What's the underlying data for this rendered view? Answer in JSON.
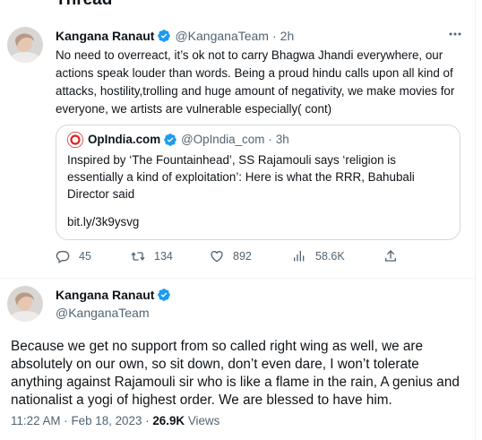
{
  "header": {
    "title": "Thread"
  },
  "tweet": {
    "author_name": "Kangana Ranaut",
    "handle": "@KanganaTeam",
    "separator": "·",
    "time": "2h",
    "text": "No need to overreact, it’s ok not to carry Bhagwa Jhandi everywhere, our actions speak louder than words. Being a proud hindu calls upon all kind of attacks, hostility,trolling and huge amount of negativity, we make movies for everyone, we artists are vulnerable especially( cont)",
    "quote": {
      "source_name": "OpIndia.com",
      "source_handle": "@OpIndia_com",
      "separator": "·",
      "time": "3h",
      "text": "Inspired by ‘The Fountainhead’, SS Rajamouli says ‘religion is essentially a kind of exploitation’: Here is what the RRR, Bahubali Director said",
      "link": "bit.ly/3k9ysvg"
    },
    "actions": {
      "replies": "45",
      "retweets": "134",
      "likes": "892",
      "views": "58.6K"
    }
  },
  "main_tweet": {
    "author_name": "Kangana Ranaut",
    "handle": "@KanganaTeam",
    "text": "Because we get no support from so called right wing as well, we are absolutely on our own, so sit down, don’t even dare, I won’t tolerate anything against Rajamouli sir who is like a flame in the rain, A genius and nationalist a yogi of highest order. We are blessed to have him.",
    "timestamp": "11:22 AM · Feb 18, 2023",
    "meta_separator": "·",
    "views_count": "26.9K",
    "views_label": "Views"
  },
  "colors": {
    "text": "#0f1419",
    "muted": "#536471",
    "verified": "#1d9bf0",
    "border": "#cfd9de",
    "divider": "#eff3f4",
    "opindia_logo": "#d62828"
  },
  "icons": [
    "verified-badge-icon",
    "more-icon",
    "reply-icon",
    "retweet-icon",
    "like-icon",
    "views-icon",
    "share-icon"
  ]
}
